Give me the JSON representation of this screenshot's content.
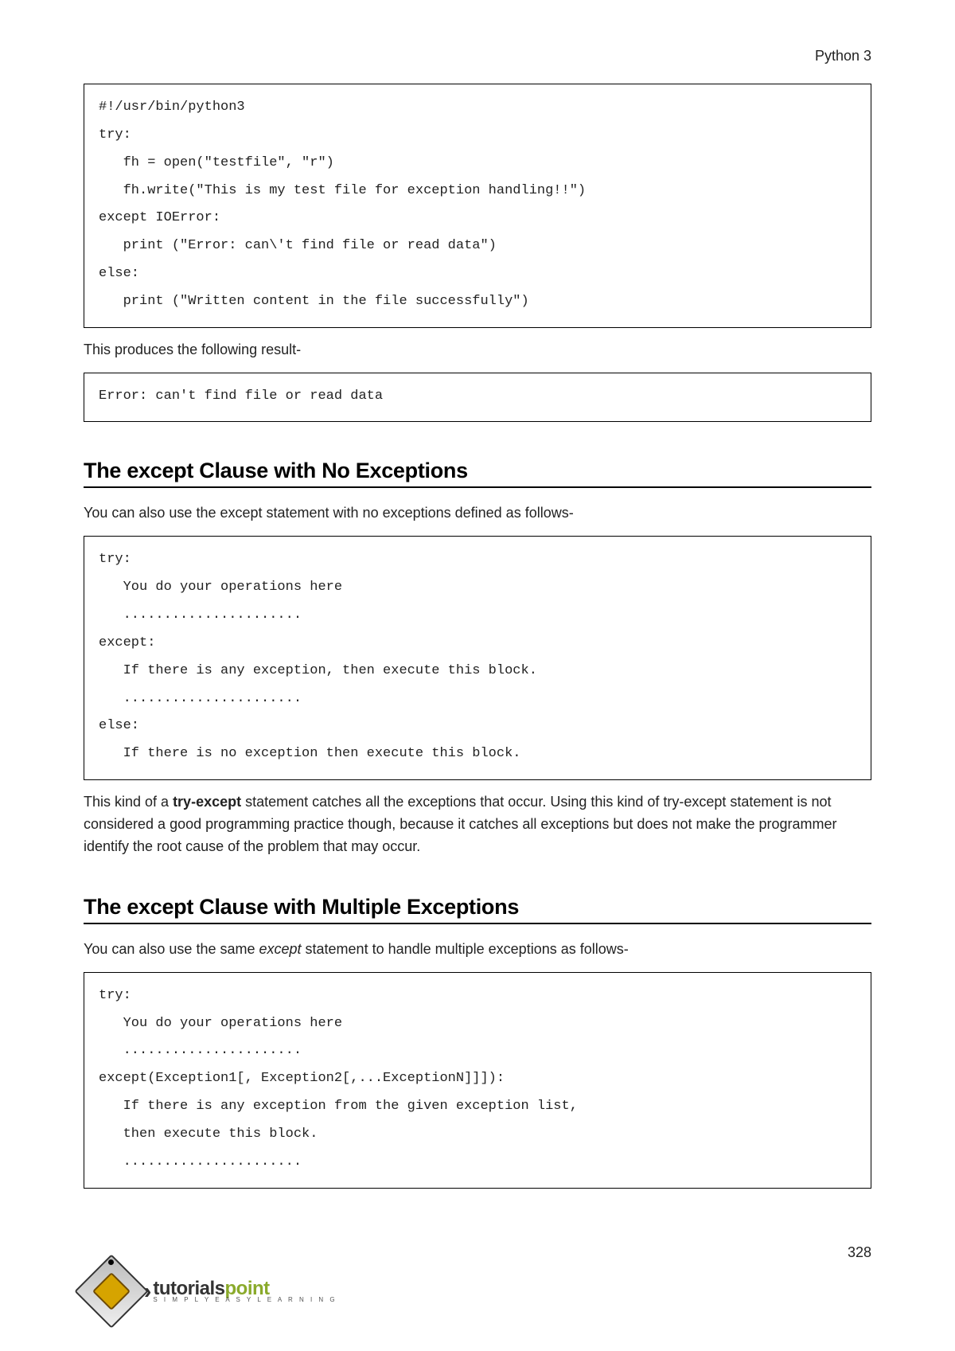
{
  "header": {
    "title": "Python 3"
  },
  "codeblocks": {
    "cb1": "#!/usr/bin/python3\ntry:\n   fh = open(\"testfile\", \"r\")\n   fh.write(\"This is my test file for exception handling!!\")\nexcept IOError:\n   print (\"Error: can\\'t find file or read data\")\nelse:\n   print (\"Written content in the file successfully\")",
    "cb2": "Error: can't find file or read data",
    "cb3": "try:\n   You do your operations here\n   ......................\nexcept:\n   If there is any exception, then execute this block.\n   ......................\nelse:\n   If there is no exception then execute this block.",
    "cb4": "try:\n   You do your operations here\n   ......................\nexcept(Exception1[, Exception2[,...ExceptionN]]]):\n   If there is any exception from the given exception list,\n   then execute this block.\n   ......................"
  },
  "paras": {
    "p1": "This produces the following result-",
    "p2": "You can also use the except statement with no exceptions defined as follows-",
    "p3_pre": "This kind of a ",
    "p3_bold": "try-except",
    "p3_post": " statement catches all the exceptions that occur. Using this kind of try-except statement is not considered a good programming practice though, because it catches all exceptions but does not make the programmer identify the root cause of the problem that may occur.",
    "p4_pre": "You can also use the same ",
    "p4_em": "except",
    "p4_post": " statement to handle multiple exceptions as follows-"
  },
  "headings": {
    "h1_pre": "The ",
    "h1_kw": "except",
    "h1_post": " Clause with No Exceptions",
    "h2_pre": "The ",
    "h2_kw": "except",
    "h2_post": " Clause with Multiple Exceptions"
  },
  "footer": {
    "page": "328"
  },
  "logo": {
    "t1": "tutorials",
    "t2": "point",
    "sub": "S I M P L Y E A S Y L E A R N I N G"
  }
}
